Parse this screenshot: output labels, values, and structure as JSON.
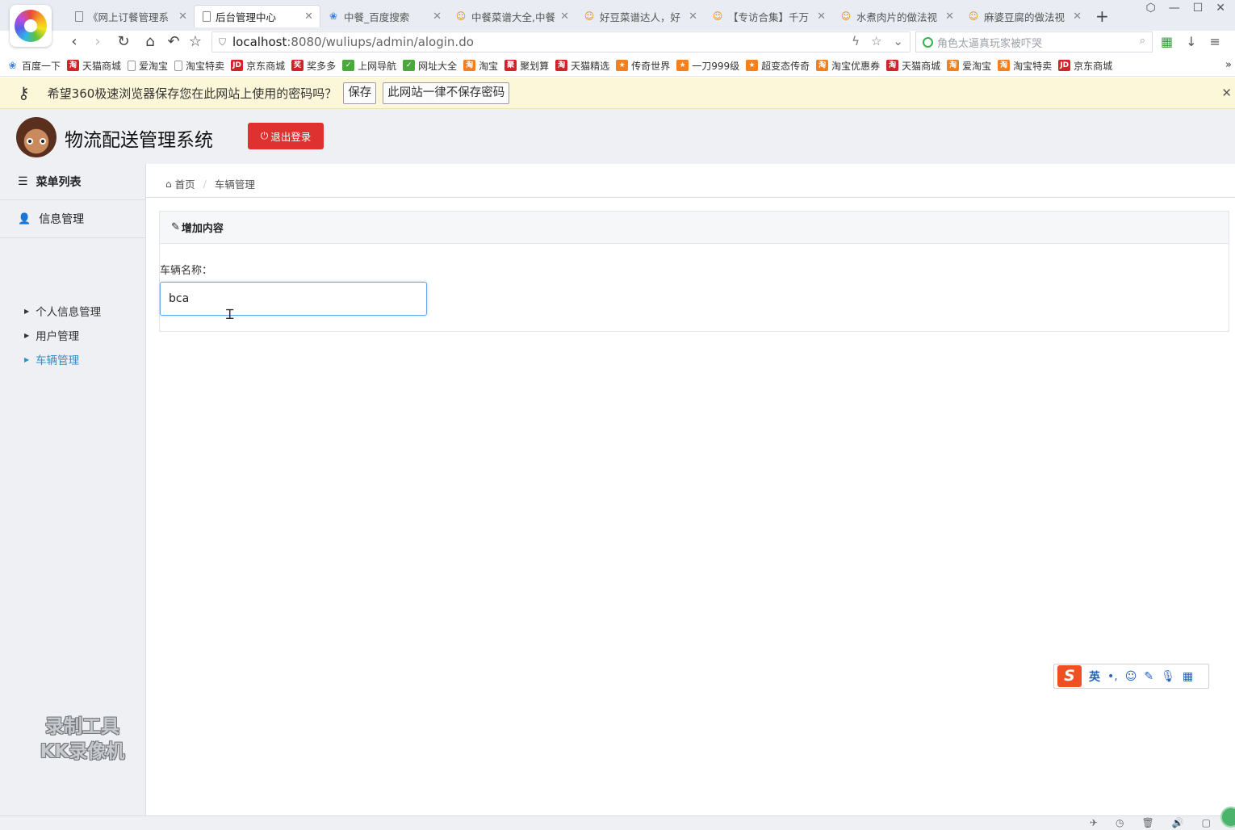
{
  "browser": {
    "tabs": [
      {
        "title": "《网上订餐管理系",
        "icon": "page-icon"
      },
      {
        "title": "后台管理中心",
        "icon": "page-icon",
        "active": true
      },
      {
        "title": "中餐_百度搜索",
        "icon": "baidu-paw-icon"
      },
      {
        "title": "中餐菜谱大全,中餐",
        "icon": "chef-icon"
      },
      {
        "title": "好豆菜谱达人，好",
        "icon": "chef-icon"
      },
      {
        "title": "【专访合集】千万",
        "icon": "chef-icon"
      },
      {
        "title": "水煮肉片的做法视",
        "icon": "chef-icon"
      },
      {
        "title": "麻婆豆腐的做法视",
        "icon": "chef-icon"
      }
    ],
    "new_tab": "+",
    "address": {
      "host": "localhost",
      "rest": ":8080/wuliups/admin/alogin.do"
    },
    "search_placeholder": "角色太逼真玩家被吓哭",
    "bookmarks": [
      {
        "label": "百度一下",
        "icon": "baidu-paw-icon"
      },
      {
        "label": "天猫商城",
        "icon": "tmall-icon"
      },
      {
        "label": "爱淘宝",
        "icon": "page-icon"
      },
      {
        "label": "淘宝特卖",
        "icon": "page-icon"
      },
      {
        "label": "京东商城",
        "icon": "jd-icon"
      },
      {
        "label": "奖多多",
        "icon": "jiang-icon"
      },
      {
        "label": "上网导航",
        "icon": "hao-icon"
      },
      {
        "label": "网址大全",
        "icon": "hao-icon"
      },
      {
        "label": "淘宝",
        "icon": "taobao-icon"
      },
      {
        "label": "聚划算",
        "icon": "ju-icon"
      },
      {
        "label": "天猫精选",
        "icon": "tmall-icon"
      },
      {
        "label": "传奇世界",
        "icon": "game-icon"
      },
      {
        "label": "一刀999级",
        "icon": "game-icon"
      },
      {
        "label": "超变态传奇",
        "icon": "game-icon"
      },
      {
        "label": "淘宝优惠券",
        "icon": "taobao-icon"
      },
      {
        "label": "天猫商城",
        "icon": "tmall-icon"
      },
      {
        "label": "爱淘宝",
        "icon": "taobao-icon"
      },
      {
        "label": "淘宝特卖",
        "icon": "taobao-icon"
      },
      {
        "label": "京东商城",
        "icon": "jd-icon"
      }
    ],
    "password_bar": {
      "message": "希望360极速浏览器保存您在此网站上使用的密码吗？",
      "save": "保存",
      "never": "此网站一律不保存密码"
    }
  },
  "app": {
    "title": "物流配送管理系统",
    "logout": "退出登录",
    "sidebar": {
      "menu_title": "菜单列表",
      "group": "信息管理",
      "items": [
        {
          "label": "个人信息管理"
        },
        {
          "label": "用户管理"
        },
        {
          "label": "车辆管理",
          "active": true
        }
      ]
    },
    "breadcrumb": {
      "home": "首页",
      "current": "车辆管理"
    },
    "panel": {
      "heading": "增加内容",
      "field_label": "车辆名称：",
      "field_value": "bca"
    },
    "watermark": {
      "line1": "录制工具",
      "line2": "KK录像机"
    },
    "ime": {
      "lang": "英",
      "punct": "•,"
    }
  },
  "colors": {
    "logout_bg": "#e03131",
    "active_link": "#2f8fce",
    "input_focus": "#66a9e6"
  }
}
